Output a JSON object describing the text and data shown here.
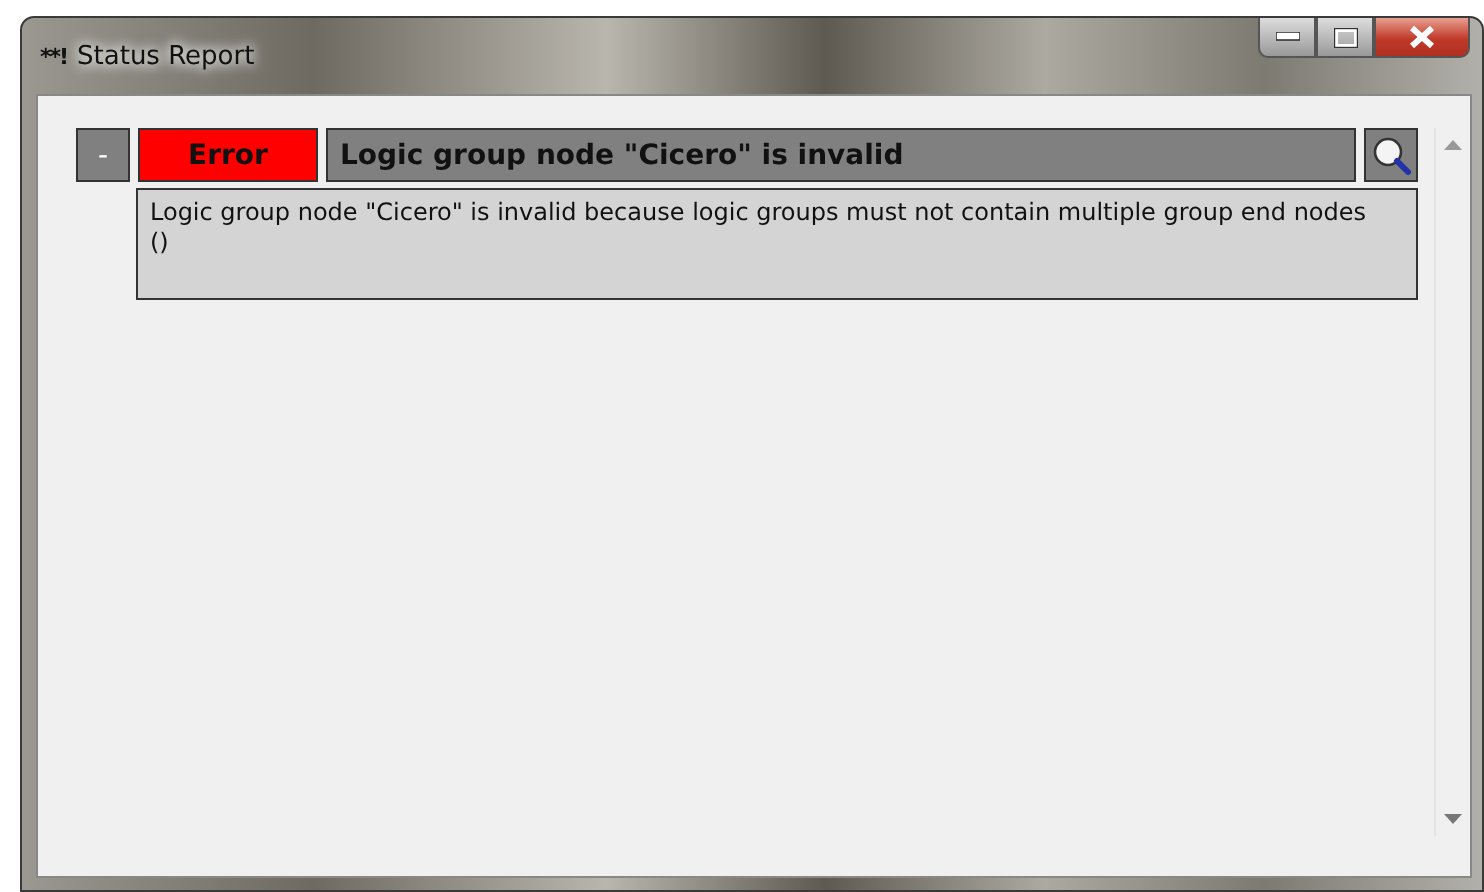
{
  "window": {
    "app_mark": "**!",
    "title": "Status Report"
  },
  "entries": [
    {
      "kind": "error",
      "toggle": "-",
      "severity": "Error",
      "title": "Logic group node \"Cicero\" is invalid",
      "expanded": true,
      "details": [
        "Logic group node \"Cicero\" is invalid because logic groups must not contain multiple group end nodes",
        "()"
      ]
    }
  ]
}
